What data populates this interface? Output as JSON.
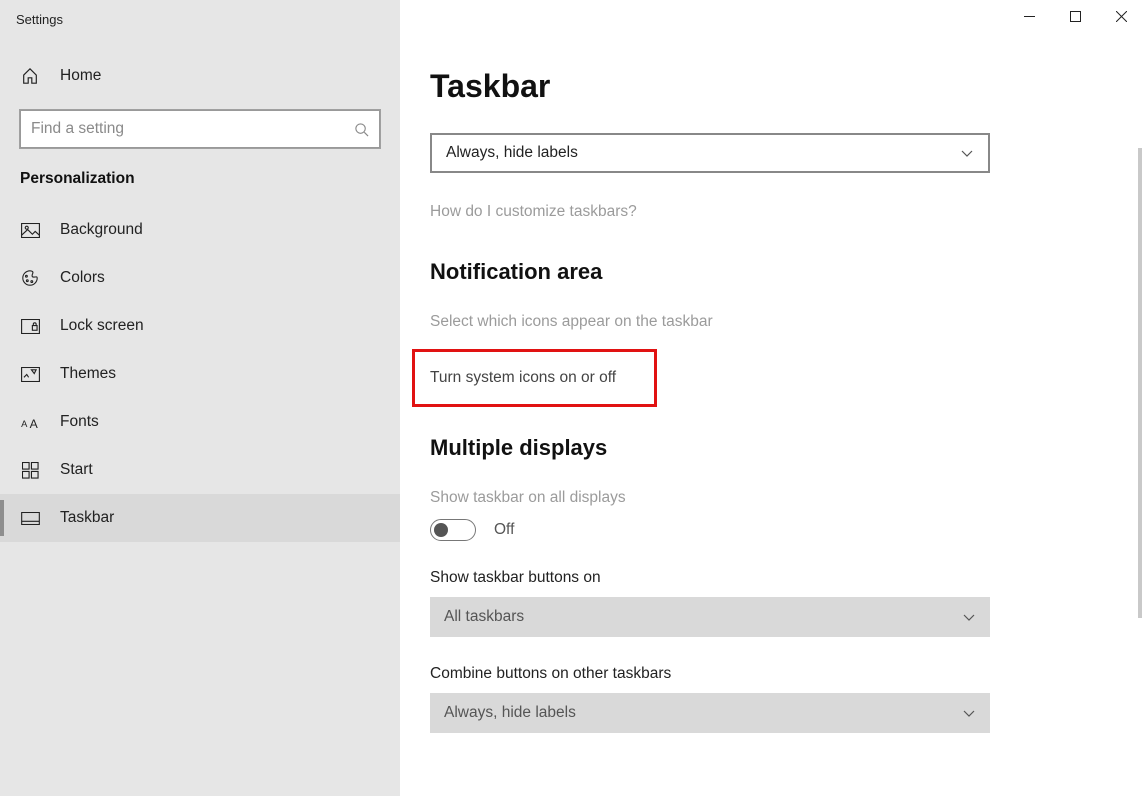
{
  "titlebar": {
    "app_name": "Settings"
  },
  "sidebar": {
    "home_label": "Home",
    "search_placeholder": "Find a setting",
    "section_title": "Personalization",
    "items": [
      {
        "label": "Background"
      },
      {
        "label": "Colors"
      },
      {
        "label": "Lock screen"
      },
      {
        "label": "Themes"
      },
      {
        "label": "Fonts"
      },
      {
        "label": "Start"
      },
      {
        "label": "Taskbar"
      }
    ]
  },
  "content": {
    "page_title": "Taskbar",
    "combine_select_value": "Always, hide labels",
    "help_link": "How do I customize taskbars?",
    "notification_heading": "Notification area",
    "notif_link1": "Select which icons appear on the taskbar",
    "notif_link2": "Turn system icons on or off",
    "multi_heading": "Multiple displays",
    "multi_toggle_label": "Show taskbar on all displays",
    "multi_toggle_state": "Off",
    "show_buttons_label": "Show taskbar buttons on",
    "show_buttons_value": "All taskbars",
    "combine_other_label": "Combine buttons on other taskbars",
    "combine_other_value": "Always, hide labels"
  }
}
